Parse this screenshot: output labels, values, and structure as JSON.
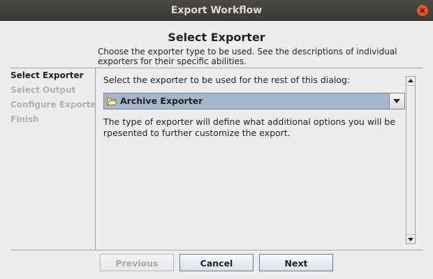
{
  "window": {
    "title": "Export Workflow",
    "close_icon": "close-icon"
  },
  "header": {
    "title": "Select Exporter",
    "description": "Choose the exporter type to be used. See the descriptions of individual exporters for their specific abilities."
  },
  "steps": [
    {
      "label": "Select Exporter",
      "active": true
    },
    {
      "label": "Select Output",
      "active": false
    },
    {
      "label": "Configure Exporter",
      "active": false
    },
    {
      "label": "Finish",
      "active": false
    }
  ],
  "main": {
    "prompt": "Select the exporter to be used for the rest of this dialog:",
    "exporter_select": {
      "selected": "Archive Exporter",
      "icon": "folder-icon"
    },
    "description": "The type of exporter will define what additional options you will be rpesented to further customize the export."
  },
  "buttons": {
    "previous": "Previous",
    "cancel": "Cancel",
    "next": "Next"
  },
  "colors": {
    "titlebar": "#3c3b37",
    "close": "#e95420",
    "combo_selected": "#a6b7cc"
  }
}
